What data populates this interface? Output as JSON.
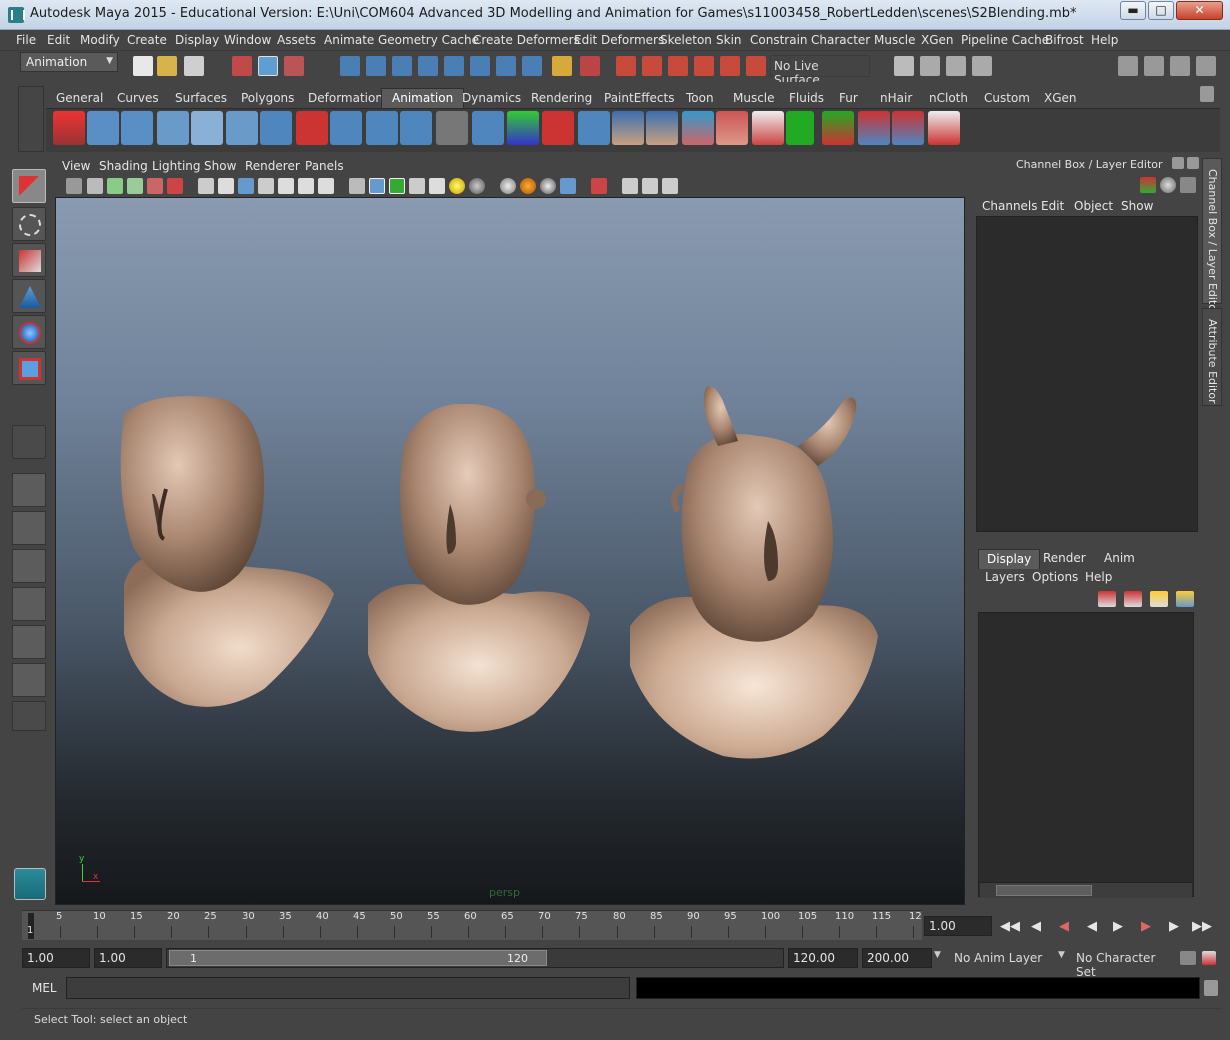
{
  "window": {
    "title": "Autodesk Maya 2015 - Educational Version: E:\\Uni\\COM604 Advanced 3D Modelling and Animation for Games\\s11003458_RobertLedden\\scenes\\S2Blending.mb*",
    "min_icon": "minimize-icon",
    "max_icon": "maximize-icon",
    "close_icon": "close-icon"
  },
  "menubar": {
    "items": [
      "File",
      "Edit",
      "Modify",
      "Create",
      "Display",
      "Window",
      "Assets",
      "Animate",
      "Geometry Cache",
      "Create Deformers",
      "Edit Deformers",
      "Skeleton",
      "Skin",
      "Constrain",
      "Character",
      "Muscle",
      "XGen",
      "Pipeline Cache",
      "Bifrost",
      "Help"
    ]
  },
  "statusline": {
    "menu_set": "Animation",
    "live_surface": "No Live Surface"
  },
  "shelf": {
    "tabs": [
      "General",
      "Curves",
      "Surfaces",
      "Polygons",
      "Deformation",
      "Animation",
      "Dynamics",
      "Rendering",
      "PaintEffects",
      "Toon",
      "Muscle",
      "Fluids",
      "Fur",
      "nHair",
      "nCloth",
      "Custom",
      "XGen"
    ],
    "active_tab": "Animation"
  },
  "panel": {
    "menus": [
      "View",
      "Shading",
      "Lighting",
      "Show",
      "Renderer",
      "Panels"
    ],
    "camera_label": "persp",
    "axis_x": "x",
    "axis_y": "y"
  },
  "channel_box": {
    "title": "Channel Box / Layer Editor",
    "menus": [
      "Channels",
      "Edit",
      "Object",
      "Show"
    ],
    "side_tab_1": "Channel Box / Layer Editor",
    "side_tab_2": "Attribute Editor"
  },
  "layer_editor": {
    "tabs": [
      "Display",
      "Render",
      "Anim"
    ],
    "active_tab": "Display",
    "menus": [
      "Layers",
      "Options",
      "Help"
    ]
  },
  "timeslider": {
    "ticks": [
      "5",
      "10",
      "15",
      "20",
      "25",
      "30",
      "35",
      "40",
      "45",
      "50",
      "55",
      "60",
      "65",
      "70",
      "75",
      "80",
      "85",
      "90",
      "95",
      "100",
      "105",
      "110",
      "115",
      "12"
    ],
    "current_marker": "1",
    "current_frame": "1.00"
  },
  "range": {
    "start_time": "1.00",
    "playback_start": "1.00",
    "range_start_label": "1",
    "range_end_label": "120",
    "playback_end": "120.00",
    "end_time": "200.00",
    "anim_layer": "No Anim Layer",
    "character_set": "No Character Set"
  },
  "commandline": {
    "language": "MEL"
  },
  "helpline": {
    "text": "Select Tool: select an object"
  },
  "colors": {
    "ui_bg": "#444444",
    "skin": "#b08e78",
    "viewport_top": "#8a9bb1",
    "viewport_bottom": "#15181b",
    "active_tool": "#888888"
  }
}
